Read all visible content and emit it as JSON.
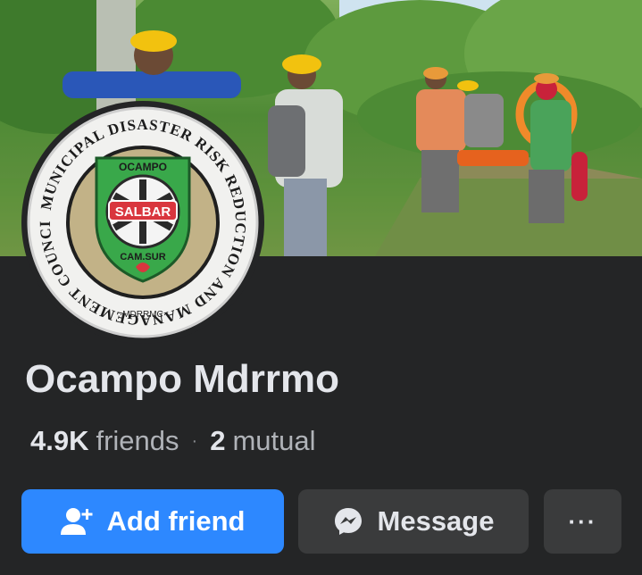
{
  "cover": {
    "description_icon": "cover-photo"
  },
  "avatar": {
    "ring_text": "MUNICIPAL DISASTER RISK REDUCTION AND MANAGEMENT COUNCIL",
    "top_label": "OCAMPO",
    "badge": "SALBAR",
    "bottom_label": "CAM.SUR",
    "acronym": "·MDRRMC·"
  },
  "profile": {
    "name": "Ocampo Mdrrmo",
    "friends_count": "4.9K",
    "friends_label": "friends",
    "mutual_count": "2",
    "mutual_label": "mutual"
  },
  "actions": {
    "add_friend": "Add friend",
    "message": "Message",
    "more": "···"
  },
  "colors": {
    "background": "#242526",
    "primary": "#2d88ff",
    "secondary_button": "#3a3b3c",
    "text": "#e4e6eb",
    "muted": "#b0b3b8"
  }
}
